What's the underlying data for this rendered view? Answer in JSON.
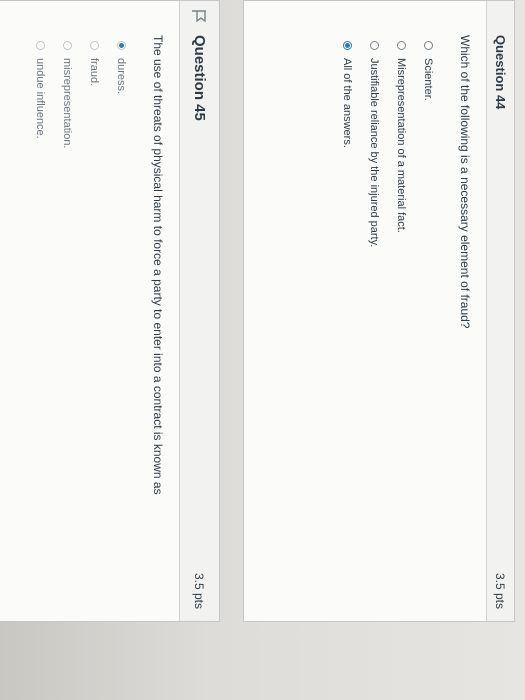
{
  "question44": {
    "title": "Question 44",
    "points": "3.5 pts",
    "text": "Which of the following is a necessary element of fraud?",
    "answers": [
      {
        "label": "Scienter.",
        "selected": false
      },
      {
        "label": "Misrepresentation of a material fact.",
        "selected": false
      },
      {
        "label": "Justifiable reliance by the injured party.",
        "selected": false
      },
      {
        "label": "All of the answers.",
        "selected": true
      }
    ]
  },
  "question45": {
    "title": "Question 45",
    "points": "3.5 pts",
    "text": "The use of threats of physical harm to force a party to enter into a contract is known as",
    "answers": [
      {
        "label": "duress.",
        "selected": true
      },
      {
        "label": "fraud.",
        "selected": false
      },
      {
        "label": "misrepresentation.",
        "selected": false
      },
      {
        "label": "undue influence.",
        "selected": false
      }
    ]
  },
  "colors": {
    "accent": "#2b7abc"
  },
  "icons": {
    "flag": "flag-icon"
  }
}
